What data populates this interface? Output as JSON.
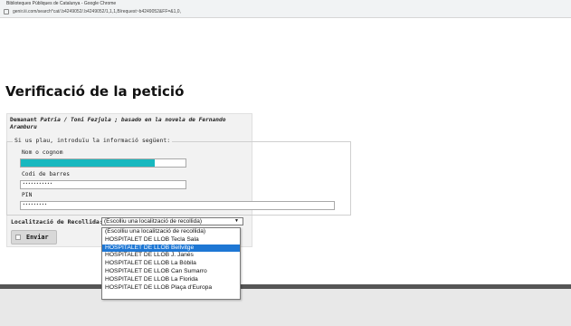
{
  "browser": {
    "window_title": "Biblioteques Públiques de Catalunya - Google Chrome",
    "url": "genir.iii.com/search*cat/.b4249052/.b4249052/1,1,1,B/request~b4249052&FF=&1,0,"
  },
  "page": {
    "title": "Verificació de la petició",
    "request_prefix": "Demanant ",
    "request_title": "Patria / Toni Fezjula ; basado en la novela de Fernando Aramburu"
  },
  "form": {
    "legend": "Si us plau, introduïu la informació següent:",
    "name_label": "Nom o cognom",
    "name_value": "",
    "barcode_label": "Codi de barres",
    "barcode_value": "•••••••••••",
    "pin_label": "PIN",
    "pin_value": "•••••••••",
    "pickup_label": "Localització de Recollida:",
    "pickup_selected": "(Escolliu una localització de recollida)",
    "pickup_options": [
      "(Escolliu una localització de recollida)",
      "HOSPITALET DE LLOB Tecla Sala",
      "HOSPITALET DE LLOB Bellvitge",
      "HOSPITALET DE LLOB J. Janés",
      "HOSPITALET DE LLOB La Bòbila",
      "HOSPITALET DE LLOB Can Sumarro",
      "HOSPITALET DE LLOB La Florida",
      "HOSPITALET DE LLOB Plaça d'Europa"
    ],
    "highlighted_option_index": 2,
    "submit_label": "Enviar"
  },
  "colors": {
    "redaction": "#18b8bf",
    "highlight": "#1e77d4"
  }
}
